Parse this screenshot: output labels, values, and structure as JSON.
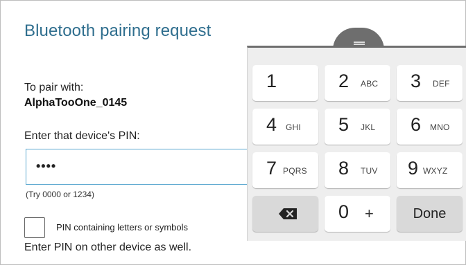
{
  "dialog": {
    "title": "Bluetooth pairing request",
    "pair_label": "To pair with:",
    "device_name": "AlphaTooOne_0145",
    "pin_label": "Enter that device's PIN:",
    "pin_value": "••••",
    "hint": "(Try 0000 or 1234)",
    "checkbox_label": "PIN containing letters or symbols",
    "footer": "Enter PIN on other device as well."
  },
  "keyboard": {
    "handle_icon": "drag-handle-icon",
    "keys": {
      "k1": {
        "num": "1",
        "letters": ""
      },
      "k2": {
        "num": "2",
        "letters": "ABC"
      },
      "k3": {
        "num": "3",
        "letters": "DEF"
      },
      "k4": {
        "num": "4",
        "letters": "GHI"
      },
      "k5": {
        "num": "5",
        "letters": "JKL"
      },
      "k6": {
        "num": "6",
        "letters": "MNO"
      },
      "k7": {
        "num": "7",
        "letters": "PQRS"
      },
      "k8": {
        "num": "8",
        "letters": "TUV"
      },
      "k9": {
        "num": "9",
        "letters": "WXYZ"
      },
      "k0": {
        "num": "0",
        "letters": "+"
      }
    },
    "backspace_icon": "backspace-icon",
    "done_label": "Done"
  },
  "colors": {
    "title": "#2f6e8e",
    "field_border": "#5aa7cf",
    "keyboard_bg": "#eeeeee",
    "key_bg": "#ffffff",
    "key_action_bg": "#d9d9d9"
  }
}
